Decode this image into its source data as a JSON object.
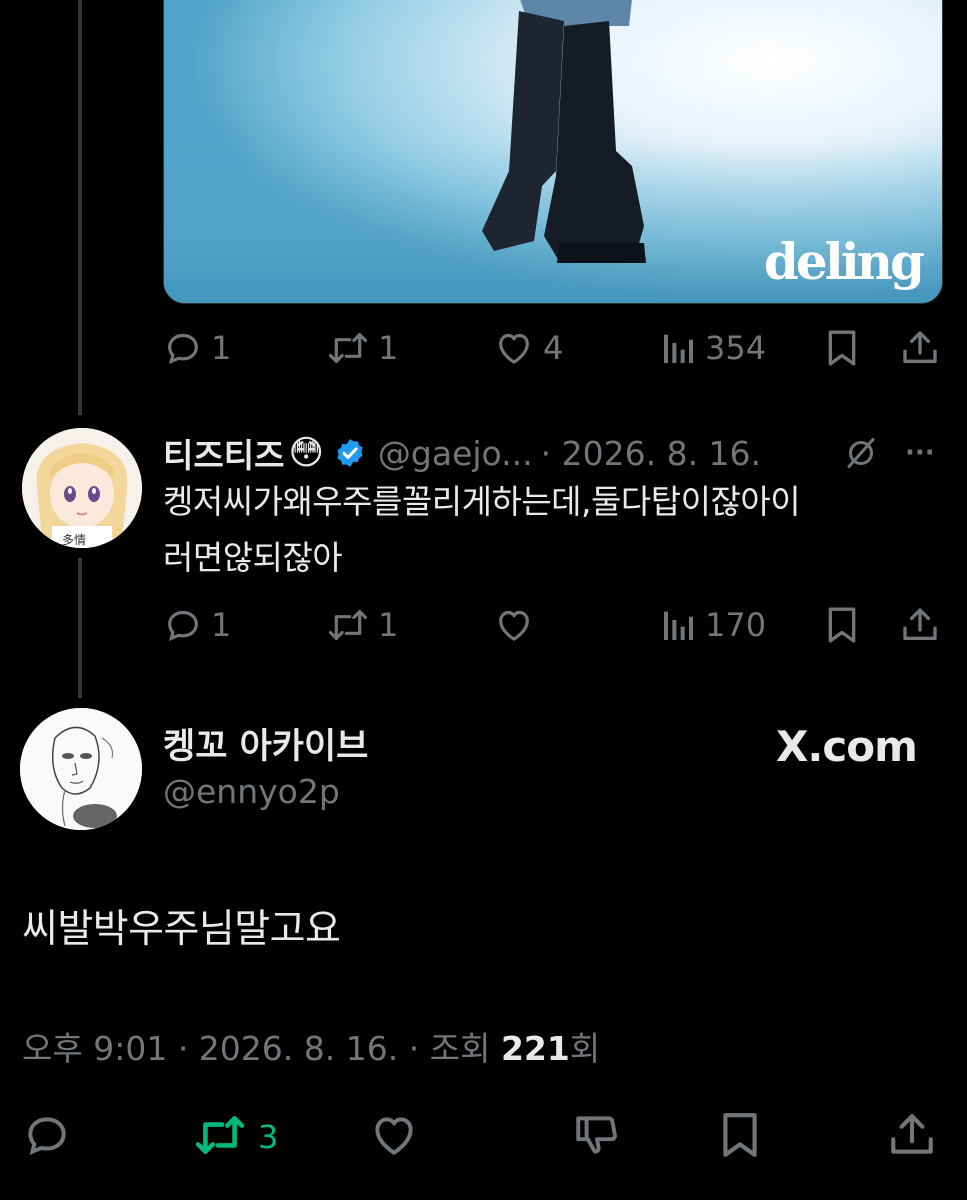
{
  "media": {
    "brand": "deling"
  },
  "tweet1": {
    "stats": {
      "replies": "1",
      "retweets": "1",
      "likes": "4",
      "views": "354"
    }
  },
  "tweet2": {
    "display_name": "티즈티즈",
    "emoji": "😳",
    "handle": "@gaejo...",
    "date": "· 2026. 8. 16.",
    "more": "···",
    "text_line1": "켕저씨가왜우주를꼴리게하는데,둘다탑이잖아이",
    "text_line2": "러면않되잖아",
    "stats": {
      "replies": "1",
      "retweets": "1",
      "likes": "",
      "views": "170"
    }
  },
  "main_tweet": {
    "display_name": "켕꼬 아카이브",
    "handle": "@ennyo2p",
    "source": "X.com",
    "text": "씨발박우주님말고요",
    "time": "오후 9:01",
    "date": "· 2026. 8. 16.",
    "views_prefix": "· 조회 ",
    "views_count": "221",
    "views_suffix": "회"
  },
  "bottom_bar": {
    "retweets": "3"
  },
  "colors": {
    "background": "#000000",
    "text": "#e7e9ea",
    "muted": "#71767b",
    "verified": "#1d9bf0",
    "retweet_active": "#00ba7c",
    "separator": "#333639"
  },
  "icons": [
    "reply-icon",
    "retweet-icon",
    "like-icon",
    "views-icon",
    "bookmark-icon",
    "share-icon",
    "verified-badge-icon",
    "grok-icon",
    "downvote-icon"
  ]
}
